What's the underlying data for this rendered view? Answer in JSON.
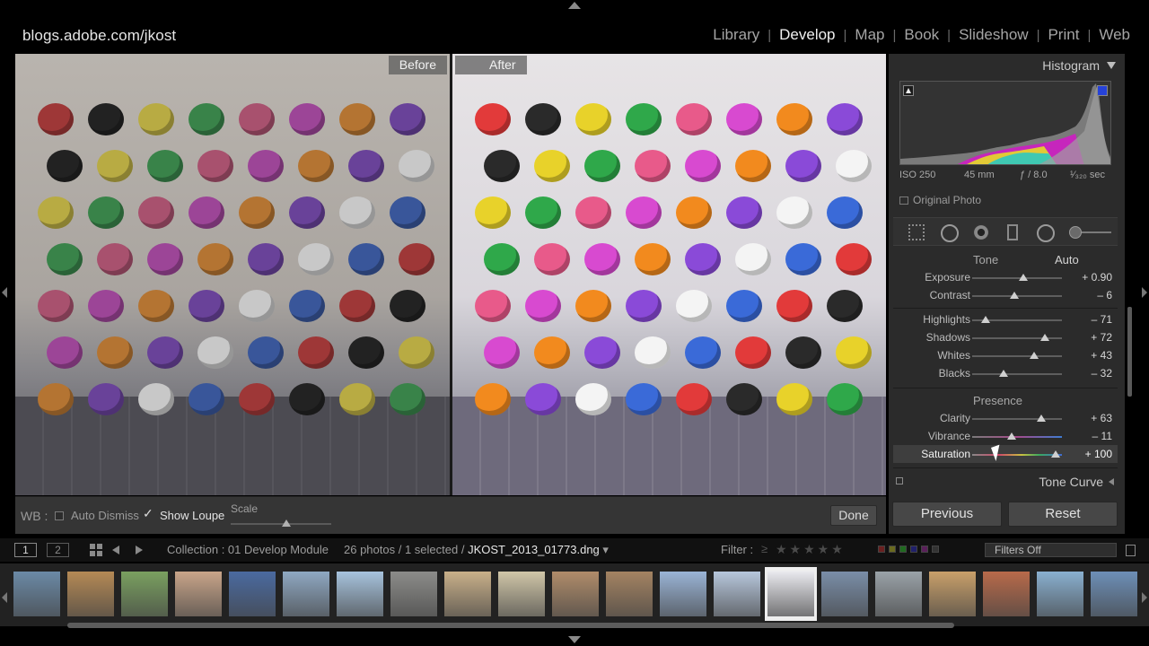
{
  "header": {
    "identity_plate": "blogs.adobe.com/jkost",
    "modules": [
      {
        "label": "Library",
        "active": false
      },
      {
        "label": "Develop",
        "active": true
      },
      {
        "label": "Map",
        "active": false
      },
      {
        "label": "Book",
        "active": false
      },
      {
        "label": "Slideshow",
        "active": false
      },
      {
        "label": "Print",
        "active": false
      },
      {
        "label": "Web",
        "active": false
      }
    ],
    "separator": "|"
  },
  "view": {
    "before_label": "Before",
    "after_label": "After"
  },
  "toolbar": {
    "wb_label": "WB :",
    "auto_dismiss_label": "Auto Dismiss",
    "auto_dismiss_checked": false,
    "show_loupe_label": "Show Loupe",
    "show_loupe_checked": true,
    "check_glyph": "✓",
    "scale_label": "Scale",
    "done_label": "Done"
  },
  "histogram": {
    "title": "Histogram",
    "iso": "ISO 250",
    "focal_length": "45 mm",
    "aperture": "ƒ / 8.0",
    "shutter": "¹⁄₃₂₀ sec",
    "original_photo_label": "Original Photo",
    "original_photo_checked": false
  },
  "tools": {
    "icons": [
      "crop-overlay-icon",
      "spot-removal-icon",
      "red-eye-icon",
      "graduated-filter-icon",
      "radial-filter-icon",
      "adjustment-brush-icon"
    ]
  },
  "basic": {
    "tone_label": "Tone",
    "auto_label": "Auto",
    "presence_label": "Presence",
    "sliders": [
      {
        "name": "Exposure",
        "value": "+ 0.90",
        "position": 0.57
      },
      {
        "name": "Contrast",
        "value": "– 6",
        "position": 0.47
      },
      {
        "name": "Highlights",
        "value": "– 71",
        "position": 0.15
      },
      {
        "name": "Shadows",
        "value": "+ 72",
        "position": 0.81
      },
      {
        "name": "Whites",
        "value": "+ 43",
        "position": 0.69
      },
      {
        "name": "Blacks",
        "value": "– 32",
        "position": 0.35
      },
      {
        "name": "Clarity",
        "value": "+ 63",
        "position": 0.77
      },
      {
        "name": "Vibrance",
        "value": "– 11",
        "position": 0.44
      },
      {
        "name": "Saturation",
        "value": "+ 100",
        "position": 0.93
      }
    ]
  },
  "tone_curve_label": "Tone Curve",
  "buttons": {
    "previous": "Previous",
    "reset": "Reset"
  },
  "filmstrip_bar": {
    "view1": "1",
    "view2": "2",
    "collection": "Collection : 01 Develop Module",
    "photo_count": "26 photos / 1 selected /",
    "filename": "JKOST_2013_01773.dng",
    "dropdown_glyph": "▾",
    "filter_label": "Filter :",
    "rating_op": "≥",
    "stars": "★★★★★",
    "filters_off": "Filters Off"
  },
  "filmstrip": {
    "thumbnails": [
      {
        "color": "#6b8aa6"
      },
      {
        "color": "#b58a55"
      },
      {
        "color": "#7aa060"
      },
      {
        "color": "#c9a58a"
      },
      {
        "color": "#4a6aa0"
      },
      {
        "color": "#8fa8c2"
      },
      {
        "color": "#a7c3dd"
      },
      {
        "color": "#8c8c8a"
      },
      {
        "color": "#c9b08a"
      },
      {
        "color": "#d0c6a8"
      },
      {
        "color": "#b08c6a"
      },
      {
        "color": "#a48362"
      },
      {
        "color": "#9ab4d6"
      },
      {
        "color": "#b7c7dc"
      },
      {
        "color": "#e9e9ee",
        "selected": true
      },
      {
        "color": "#7a8ea8"
      },
      {
        "color": "#9aa2a8"
      },
      {
        "color": "#c9a06a"
      },
      {
        "color": "#b86a4a"
      },
      {
        "color": "#8ab0d0"
      },
      {
        "color": "#6d8fb7"
      }
    ]
  }
}
